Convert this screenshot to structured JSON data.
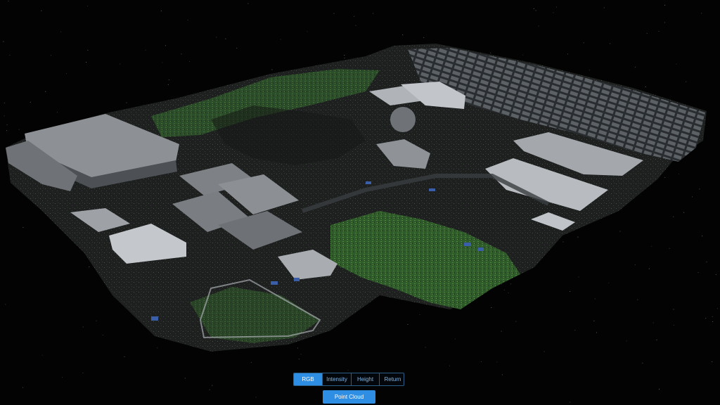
{
  "colors": {
    "background": "#030303",
    "accent": "#2d8ee3",
    "accent_text": "#ffffff",
    "inactive_text": "#7fb4e3",
    "border": "#2b5f88",
    "vegetation": "#3f6f34",
    "roof": "#9a9ea2"
  },
  "viewer": {
    "icon": "point-cloud"
  },
  "color_modes": {
    "selected": "RGB",
    "options": [
      "RGB",
      "Intensity",
      "Height",
      "Return"
    ]
  },
  "point_cloud_button": {
    "label": "Point Cloud"
  }
}
